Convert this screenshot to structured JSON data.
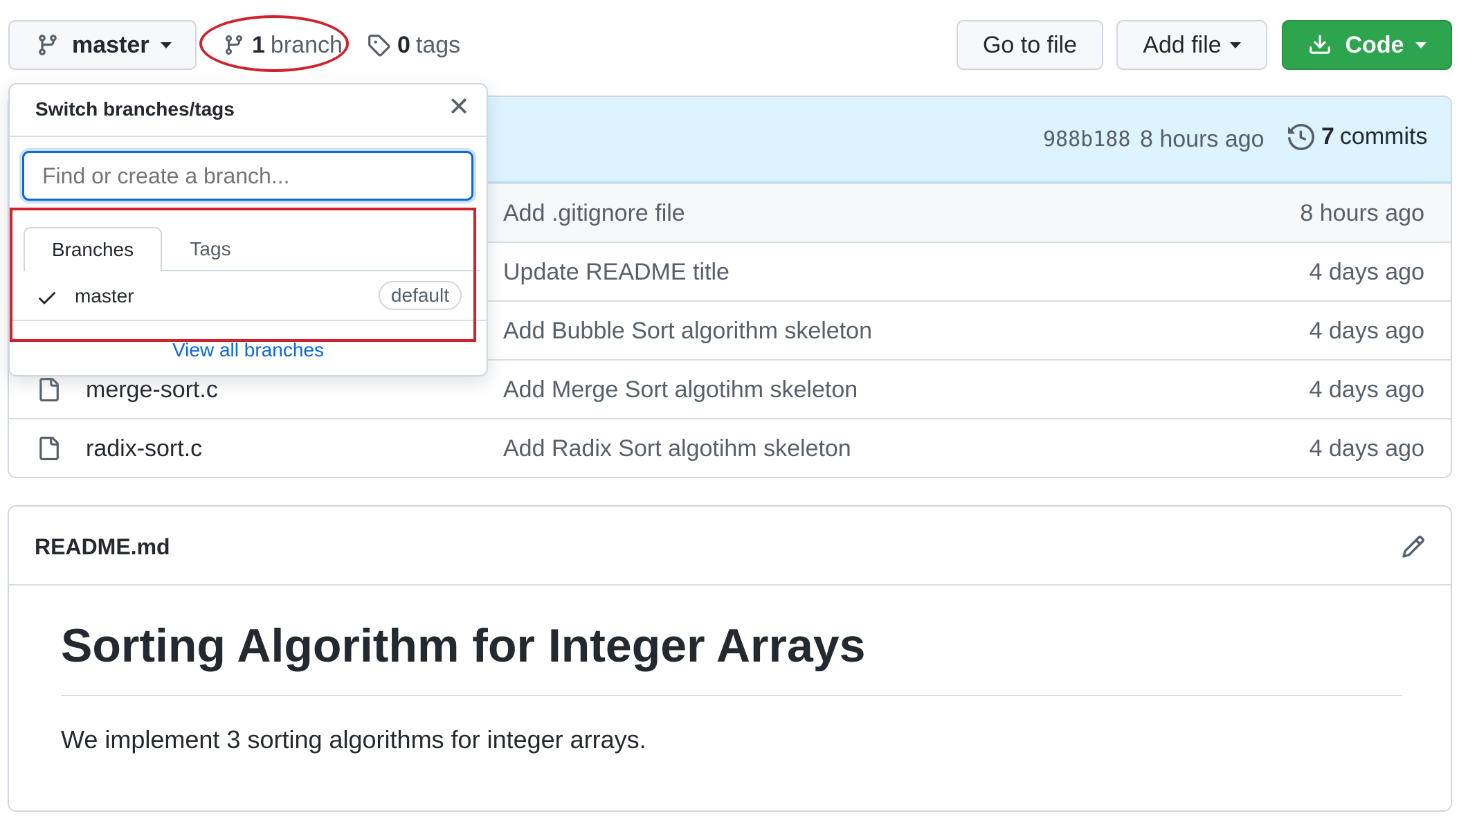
{
  "toolbar": {
    "branch_button_label": "master",
    "branch_count": "1",
    "branch_word": "branch",
    "tag_count": "0",
    "tag_word": "tags",
    "go_to_file_label": "Go to file",
    "add_file_label": "Add file",
    "code_label": "Code"
  },
  "commit_bar": {
    "hash": "988b188",
    "time": "8 hours ago",
    "commit_count": "7",
    "commit_word": "commits"
  },
  "files": [
    {
      "name": "",
      "message": "Add .gitignore file",
      "age": "8 hours ago"
    },
    {
      "name": "",
      "message": "Update README title",
      "age": "4 days ago"
    },
    {
      "name": "",
      "message": "Add Bubble Sort algorithm skeleton",
      "age": "4 days ago"
    },
    {
      "name": "merge-sort.c",
      "message": "Add Merge Sort algotihm skeleton",
      "age": "4 days ago"
    },
    {
      "name": "radix-sort.c",
      "message": "Add Radix Sort algotihm skeleton",
      "age": "4 days ago"
    }
  ],
  "dropdown": {
    "title": "Switch branches/tags",
    "search_placeholder": "Find or create a branch...",
    "tab_branches": "Branches",
    "tab_tags": "Tags",
    "branch_name": "master",
    "branch_badge": "default",
    "view_all_label": "View all branches"
  },
  "readme": {
    "filename": "README.md",
    "heading": "Sorting Algorithm for Integer Arrays",
    "body": "We implement 3 sorting algorithms for integer arrays."
  },
  "colors": {
    "accent_blue": "#0969da",
    "code_green": "#2da44e",
    "annotation_red": "#cf222e"
  },
  "icons": [
    "git-branch-icon",
    "tag-icon",
    "download-icon",
    "close-icon",
    "check-icon",
    "history-icon",
    "file-icon",
    "pencil-icon"
  ]
}
